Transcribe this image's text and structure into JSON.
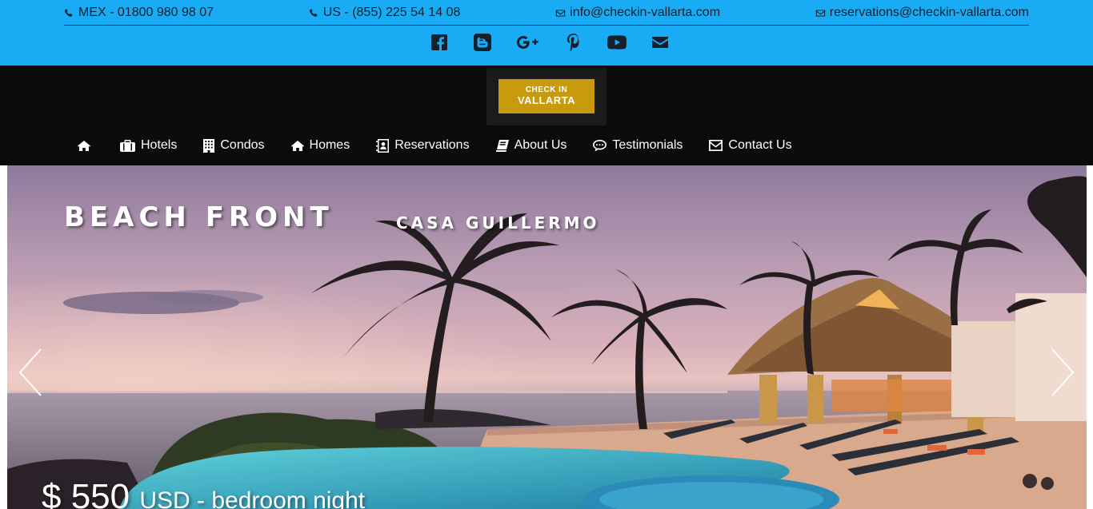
{
  "contacts": {
    "mex": "MEX - 01800 980 98 07",
    "us": "US - (855) 225 54 14 08",
    "info_email": "info@checkin-vallarta.com",
    "reservations_email": "reservations@checkin-vallarta.com"
  },
  "social": [
    "facebook-icon",
    "blogger-icon",
    "google-plus-icon",
    "pinterest-icon",
    "youtube-icon",
    "email-icon"
  ],
  "logo": {
    "line1": "CHECK IN",
    "line2": "VALLARTA"
  },
  "nav": {
    "items": [
      {
        "label": "",
        "icon": "home-icon"
      },
      {
        "label": "Hotels",
        "icon": "suitcase-icon"
      },
      {
        "label": "Condos",
        "icon": "building-icon"
      },
      {
        "label": "Homes",
        "icon": "home-icon"
      },
      {
        "label": "Reservations",
        "icon": "contact-book-icon"
      },
      {
        "label": "About Us",
        "icon": "book-icon"
      },
      {
        "label": "Testimonials",
        "icon": "comment-icon"
      },
      {
        "label": "Contact Us",
        "icon": "envelope-icon"
      }
    ]
  },
  "hero": {
    "title": "BEACH FRONT",
    "subtitle": "CASA GUILLERMO",
    "price": "$ 550",
    "price_suffix": "USD - bedroom night"
  },
  "colors": {
    "topbar": "#1aabf5",
    "header": "#0b0b0b",
    "logo": "#c89b0f"
  }
}
